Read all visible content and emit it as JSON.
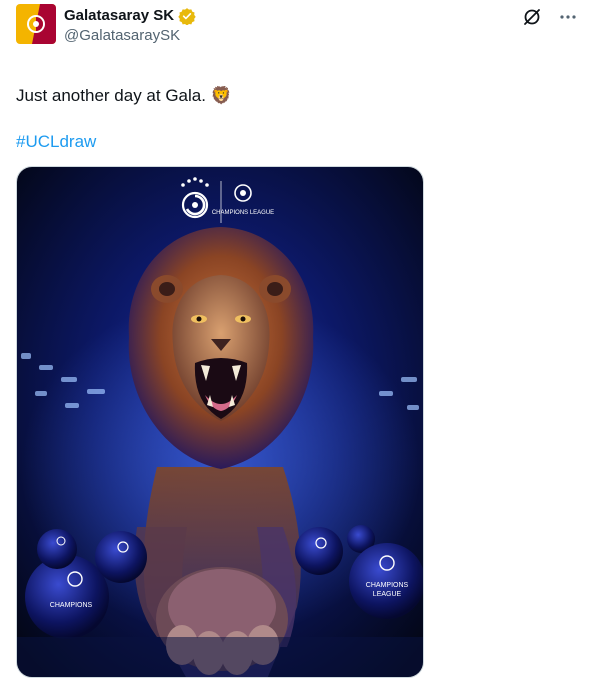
{
  "account": {
    "display_name": "Galatasaray SK",
    "handle": "@GalatasaraySK",
    "verified_color": "#f4b400",
    "avatar_colors": [
      "#f4b400",
      "#a90432"
    ]
  },
  "actions": {
    "grok_icon": "grok-slash-icon",
    "more_icon": "more-dots-icon"
  },
  "post": {
    "text": "Just another day at Gala. 🦁",
    "hashtag": "#UCLdraw"
  },
  "image": {
    "logo_text": "CHAMPIONS LEAGUE",
    "ball_text_1": "CHAMPIONS",
    "ball_text_2": "LEAGUE",
    "accent_color": "#1d9bf0"
  }
}
